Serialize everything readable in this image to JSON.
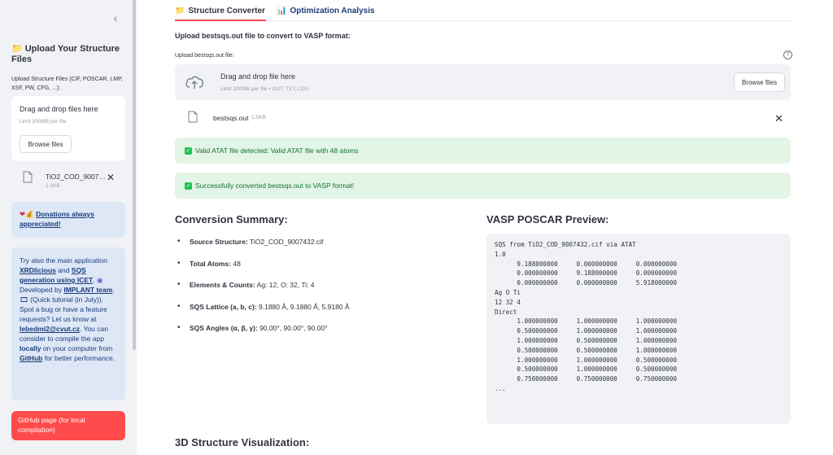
{
  "sidebar": {
    "collapse_glyph": "‹",
    "upload_title": "Upload Your Structure Files",
    "upload_label": "Upload Structure Files (CIF, POSCAR, LMP, XSF, PW, CFG, ...):",
    "drop_main": "Drag and drop files here",
    "drop_limit": "Limit 200MB per file",
    "browse_label": "Browse files",
    "file_name": "TiO2_COD_9007…",
    "file_size": "1.1KB",
    "donate_link": "Donations always appreciated!",
    "info_text_1": "Try also the main application ",
    "info_link_1": "XRDlicious",
    "info_text_2": " and ",
    "info_link_2": "SQS generation using ICET",
    "info_text_3": ". ",
    "info_text_4": " Developed by ",
    "info_link_3": "IMPLANT team",
    "info_text_5": ". ",
    "info_text_6": " (Quick tutorial (in July)). Spot a bug or have a feature requests? Let us know at ",
    "info_link_4": "lebedmi2@cvut.cz",
    "info_text_7": ". You can consider to compile the app ",
    "info_link_5": "locally",
    "info_text_8": " on your computer from ",
    "info_link_6": "GitHub",
    "info_text_9": " for better performance.",
    "github_button": "GitHub page (for local compilation)"
  },
  "tabs": [
    {
      "icon": "folder-icon",
      "label": "Structure Converter",
      "active": true
    },
    {
      "icon": "bar-chart-icon",
      "label": "Optimization Analysis",
      "active": false
    }
  ],
  "main": {
    "upload_heading": "Upload bestsqs.out file to convert to VASP format:",
    "upload_label": "Upload bestsqs.out file:",
    "help_glyph": "?",
    "drop_main": "Drag and drop file here",
    "drop_limit": "Limit 200MB per file • OUT, TXT, LOG",
    "browse_label": "Browse files",
    "file_name": "bestsqs.out",
    "file_size": "1.5KB",
    "alert_valid": "Valid ATAT file detected: Valid ATAT file with 48 atoms",
    "alert_success": "Successfully converted bestsqs.out to VASP format!",
    "summary_heading": "Conversion Summary:",
    "poscar_heading": "VASP POSCAR Preview:",
    "summary": [
      {
        "label": "Source Structure:",
        "value": " TiO2_COD_9007432.cif"
      },
      {
        "label": "Total Atoms:",
        "value": " 48"
      },
      {
        "label": "Elements & Counts:",
        "value": " Ag: 12, O: 32, Ti: 4"
      },
      {
        "label": "SQS Lattice (a, b, c):",
        "value": " 9.1880 Å, 9.1880 Å, 5.9180 Å"
      },
      {
        "label": "SQS Angles (α, β, γ):",
        "value": " 90.00°, 90.00°, 90.00°"
      }
    ],
    "poscar": "SQS from TiO2_COD_9007432.cif via ATAT\n1.0\n      9.188000000     0.000000000     0.000000000\n      0.000000000     9.188000000     0.000000000\n      0.000000000     0.000000000     5.918000000\nAg O Ti\n12 32 4\nDirect\n      1.000000000     1.000000000     1.000000000\n      0.500000000     1.000000000     1.000000000\n      1.000000000     0.500000000     1.000000000\n      0.500000000     0.500000000     1.000000000\n      1.000000000     1.000000000     0.500000000\n      0.500000000     1.000000000     0.500000000\n      0.750000000     0.750000000     0.750000000\n...",
    "viz_heading": "3D Structure Visualization:"
  },
  "colors": {
    "accent": "#ff4b4b",
    "sidebar_bg": "#f0f2f6",
    "info_bg": "#dde7f6",
    "success_bg": "#e2f5e6",
    "success_text": "#177233"
  }
}
